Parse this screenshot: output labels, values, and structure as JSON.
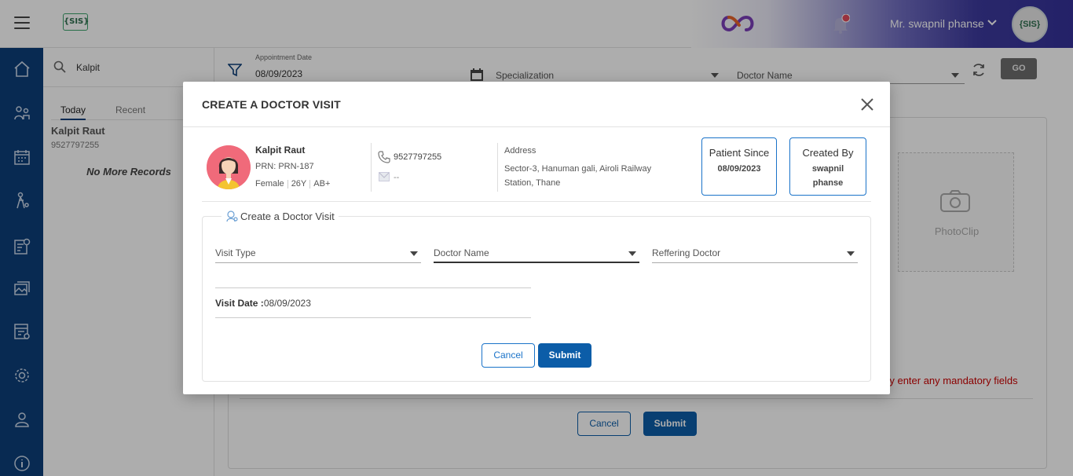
{
  "header": {
    "logo_text": "{SIS}",
    "user_name": "Mr. swapnil phanse",
    "avatar_text": "{SIS}",
    "accent_color": "#35329a"
  },
  "left_nav": {
    "icons": [
      "home-icon",
      "doctor-patient-icon",
      "calendar-icon",
      "stethoscope-icon",
      "report-icon",
      "image-gallery-icon",
      "billing-icon",
      "settings-icon",
      "doctor-icon",
      "info-icon"
    ],
    "background": "#0c3f7a"
  },
  "list_panel": {
    "search_value": "Kalpit",
    "tabs": [
      "Today",
      "Recent"
    ],
    "active_tab": "Today",
    "patient_name": "Kalpit Raut",
    "patient_phone": "9527797255",
    "no_more": "No More Records"
  },
  "filter_bar": {
    "appointment_date_label": "Appointment Date",
    "appointment_date": "08/09/2023",
    "specialization": "Specialization",
    "doctor_name": "Doctor Name",
    "go_label": "GO"
  },
  "background_form": {
    "photo_label": "PhotoClip",
    "mandatory_msg": "ndly enter any mandatory fields",
    "cancel_label": "Cancel",
    "submit_label": "Submit"
  },
  "modal": {
    "title": "CREATE A DOCTOR VISIT",
    "patient": {
      "name": "Kalpit Raut",
      "prn": "PRN: PRN-187",
      "gender": "Female",
      "age": "26Y",
      "blood_group": "AB+",
      "phone": "9527797255",
      "email": "--",
      "address_label": "Address",
      "address": "Sector-3, Hanuman gali, Airoli Railway Station, Thane"
    },
    "patient_since": {
      "title": "Patient Since",
      "value": "08/09/2023"
    },
    "created_by": {
      "title": "Created By",
      "value": "swapnil phanse"
    },
    "section_title": "Create a Doctor Visit",
    "fields": {
      "visit_type": "Visit Type",
      "doctor_name": "Doctor Name",
      "referring_doctor": "Reffering Doctor"
    },
    "visit_date_label": "Visit Date :",
    "visit_date": "08/09/2023",
    "cancel_label": "Cancel",
    "submit_label": "Submit"
  }
}
